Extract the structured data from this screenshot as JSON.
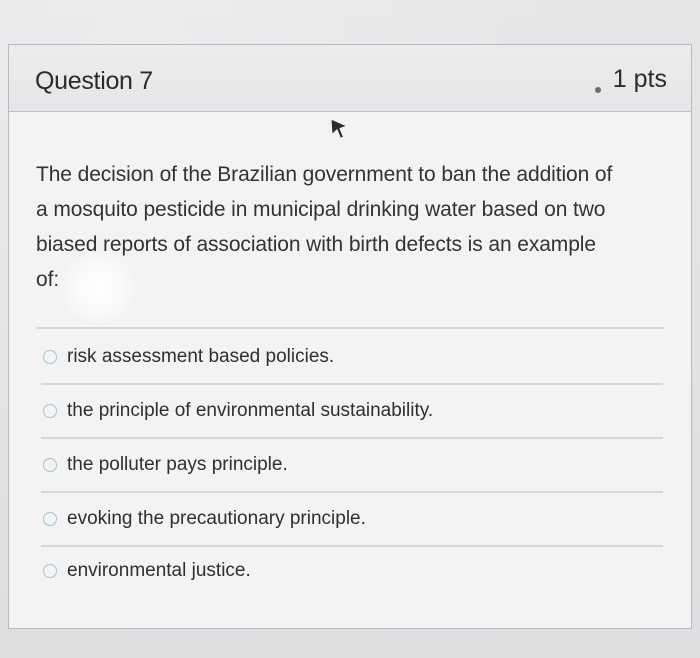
{
  "question": {
    "title": "Question 7",
    "points": "1 pts",
    "text_lines": [
      "The decision of the Brazilian government to ban the addition of",
      "a mosquito pesticide in municipal drinking water based on two",
      "biased reports of association with birth defects is an example",
      "of:"
    ]
  },
  "answers": [
    {
      "label": "risk assessment based policies."
    },
    {
      "label": "the principle of environmental sustainability."
    },
    {
      "label": "the polluter pays principle."
    },
    {
      "label": "evoking the precautionary principle."
    },
    {
      "label": "environmental justice."
    }
  ],
  "colors": {
    "text": "#2b2b2e",
    "radio_border": "#a9c3cf",
    "divider": "#d6d6d9"
  }
}
